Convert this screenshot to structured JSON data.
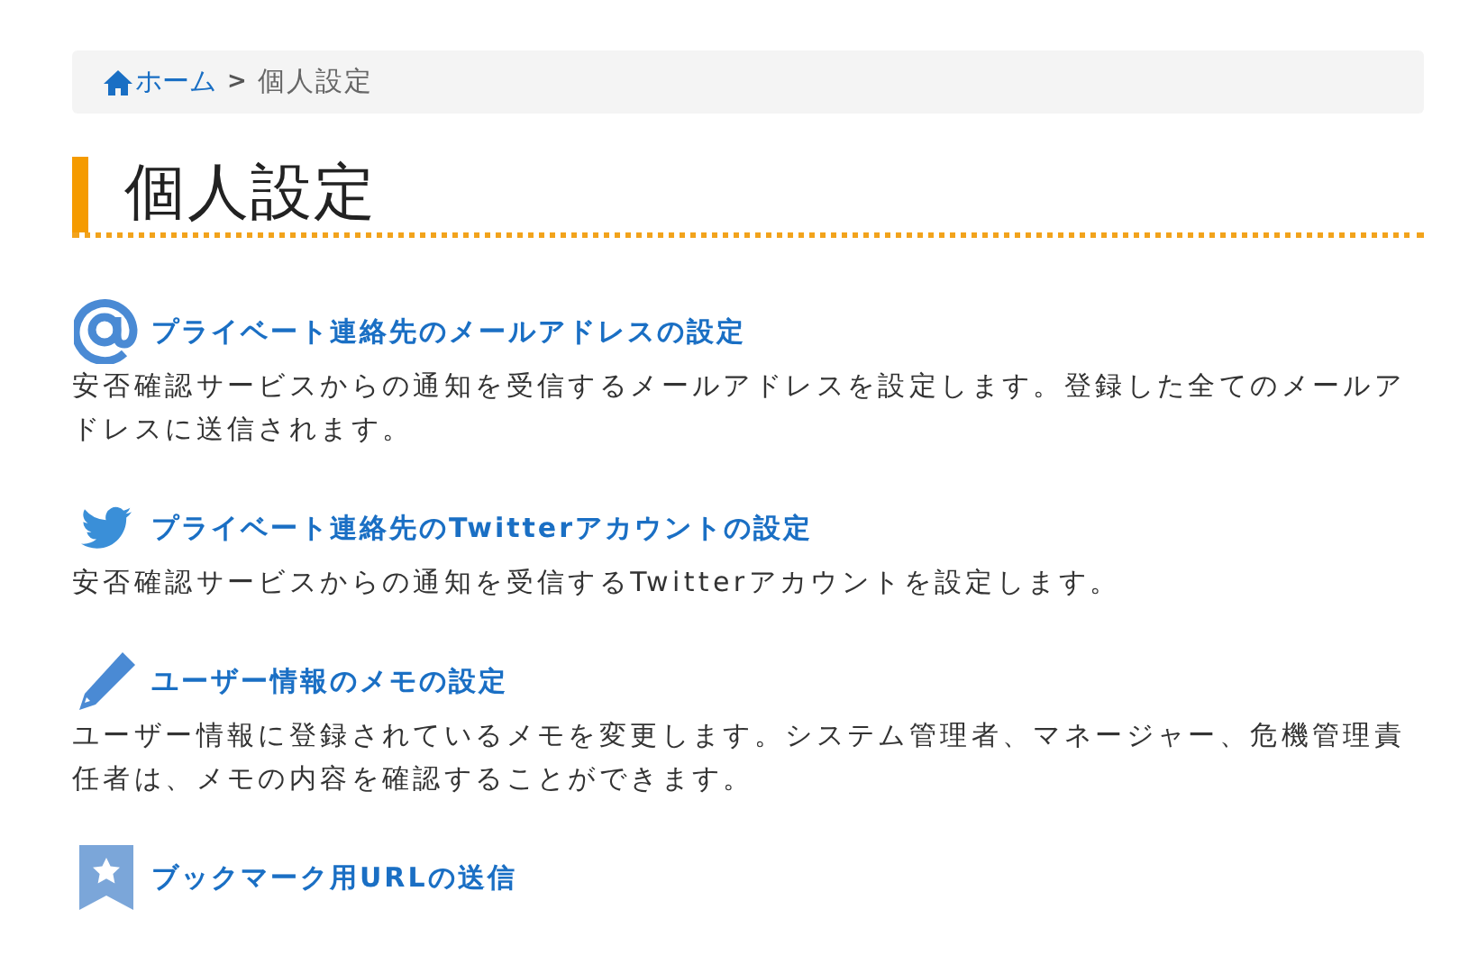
{
  "breadcrumb": {
    "home": "ホーム",
    "separator": ">",
    "current": "個人設定"
  },
  "heading": "個人設定",
  "settings": [
    {
      "kind": "email",
      "title": "プライベート連絡先のメールアドレスの設定",
      "description": "安否確認サービスからの通知を受信するメールアドレスを設定します。登録した全てのメールアドレスに送信されます。"
    },
    {
      "kind": "twitter",
      "title": "プライベート連絡先のTwitterアカウントの設定",
      "description": "安否確認サービスからの通知を受信するTwitterアカウントを設定します。"
    },
    {
      "kind": "pencil",
      "title": "ユーザー情報のメモの設定",
      "description": "ユーザー情報に登録されているメモを変更します。システム管理者、マネージャー、危機管理責任者は、メモの内容を確認することができます。"
    },
    {
      "kind": "bookmark",
      "title": "ブックマーク用URLの送信"
    }
  ]
}
